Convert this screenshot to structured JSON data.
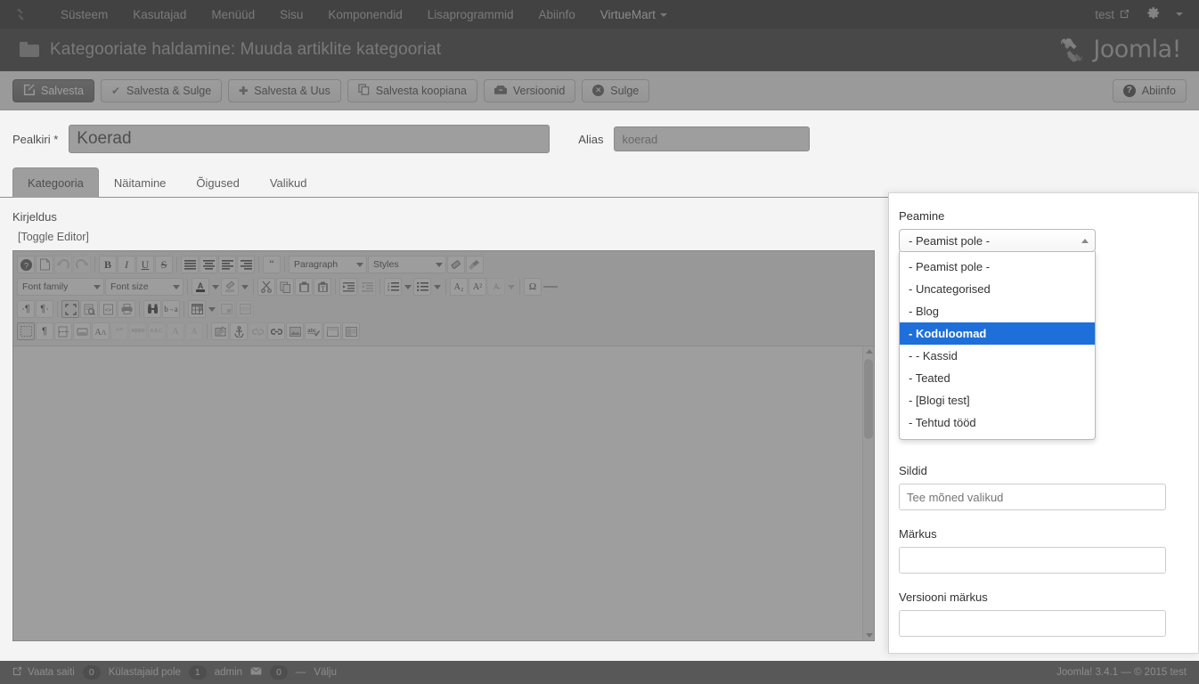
{
  "topbar": {
    "logo_icon": "joomla-logo-icon",
    "nav": [
      {
        "label": "Süsteem"
      },
      {
        "label": "Kasutajad"
      },
      {
        "label": "Menüüd"
      },
      {
        "label": "Sisu"
      },
      {
        "label": "Komponendid"
      },
      {
        "label": "Lisaprogrammid"
      },
      {
        "label": "Abiinfo"
      },
      {
        "label": "VirtueMart"
      }
    ],
    "user_label": "test",
    "user_icon": "external-link-icon",
    "gear_icon": "gear-icon",
    "caret_icon": "chevron-down-icon"
  },
  "header": {
    "icon": "folder-icon",
    "title": "Kategooriate haldamine: Muuda artiklite kategooriat",
    "brand": "Joomla!",
    "brand_mark": "®"
  },
  "toolbar": {
    "buttons": [
      {
        "label": "Salvesta",
        "icon": "edit-pencil-icon",
        "style": "primary"
      },
      {
        "label": "Salvesta & Sulge",
        "icon": "check-icon",
        "style": "default"
      },
      {
        "label": "Salvesta & Uus",
        "icon": "plus-icon",
        "style": "default"
      },
      {
        "label": "Salvesta koopiana",
        "icon": "copy-icon",
        "style": "default"
      },
      {
        "label": "Versioonid",
        "icon": "archive-icon",
        "style": "default"
      },
      {
        "label": "Sulge",
        "icon": "close-circle-icon",
        "style": "default"
      }
    ],
    "help": {
      "label": "Abiinfo",
      "icon": "question-circle-icon"
    }
  },
  "form": {
    "title_label": "Pealkiri *",
    "title_value": "Koerad",
    "alias_label": "Alias",
    "alias_placeholder": "koerad"
  },
  "tabs": [
    {
      "label": "Kategooria",
      "active": true
    },
    {
      "label": "Näitamine",
      "active": false
    },
    {
      "label": "Õigused",
      "active": false
    },
    {
      "label": "Valikud",
      "active": false
    }
  ],
  "editor": {
    "field_label": "Kirjeldus",
    "toggle_label": "[Toggle Editor]",
    "row1": [
      {
        "icon": "help-circle-icon",
        "type": "btn"
      },
      {
        "icon": "new-document-icon",
        "type": "btn"
      },
      {
        "icon": "undo-icon",
        "type": "btn",
        "dim": true
      },
      {
        "icon": "redo-icon",
        "type": "btn",
        "dim": true
      },
      {
        "icon": "bold-icon",
        "type": "btn",
        "glyph": "B"
      },
      {
        "icon": "italic-icon",
        "type": "btn",
        "glyph": "I"
      },
      {
        "icon": "underline-icon",
        "type": "btn",
        "glyph": "U"
      },
      {
        "icon": "strikethrough-icon",
        "type": "btn",
        "glyph": "S"
      },
      {
        "icon": "align-left-icon",
        "type": "btn"
      },
      {
        "icon": "align-center-icon",
        "type": "btn"
      },
      {
        "icon": "align-right-icon",
        "type": "btn"
      },
      {
        "icon": "align-justify-icon",
        "type": "btn"
      },
      {
        "icon": "blockquote-icon",
        "type": "btn",
        "glyph": "“"
      },
      {
        "icon": "paragraph-format-select",
        "type": "select",
        "label": "Paragraph",
        "width": 88
      },
      {
        "icon": "styles-select",
        "type": "select",
        "label": "Styles",
        "width": 88
      },
      {
        "icon": "eraser-icon",
        "type": "btn"
      },
      {
        "icon": "cleanup-broom-icon",
        "type": "btn"
      }
    ],
    "row2": [
      {
        "icon": "font-family-select",
        "type": "select",
        "label": "Font family",
        "width": 98
      },
      {
        "icon": "font-size-select",
        "type": "select",
        "label": "Font size",
        "width": 88
      },
      {
        "icon": "text-color-icon",
        "type": "btn",
        "glyph": "A"
      },
      {
        "icon": "text-color-chevron-icon",
        "type": "caret"
      },
      {
        "icon": "highlight-color-icon",
        "type": "btn"
      },
      {
        "icon": "highlight-color-chevron-icon",
        "type": "caret"
      },
      {
        "icon": "cut-scissors-icon",
        "type": "btn"
      },
      {
        "icon": "copy-icon",
        "type": "btn"
      },
      {
        "icon": "paste-icon",
        "type": "btn"
      },
      {
        "icon": "paste-as-text-icon",
        "type": "btn"
      },
      {
        "icon": "indent-icon",
        "type": "btn"
      },
      {
        "icon": "outdent-icon",
        "type": "btn",
        "dim": true
      },
      {
        "icon": "ordered-list-icon",
        "type": "btn"
      },
      {
        "icon": "ordered-list-chevron-icon",
        "type": "caret"
      },
      {
        "icon": "unordered-list-icon",
        "type": "btn"
      },
      {
        "icon": "unordered-list-chevron-icon",
        "type": "caret"
      },
      {
        "icon": "subscript-icon",
        "type": "btn",
        "glyph": "A₂"
      },
      {
        "icon": "superscript-icon",
        "type": "btn",
        "glyph": "A²"
      },
      {
        "icon": "remove-format-icon",
        "type": "btn",
        "dim": true
      },
      {
        "icon": "remove-format-chevron-icon",
        "type": "caret",
        "dim": true
      },
      {
        "icon": "special-character-icon",
        "type": "btn",
        "glyph": "Ω"
      },
      {
        "icon": "horizontal-rule-icon",
        "type": "btn",
        "glyph": "—",
        "plain": true
      }
    ],
    "row3": [
      {
        "icon": "ltr-direction-icon",
        "type": "btn",
        "glyph": "¶"
      },
      {
        "icon": "rtl-direction-icon",
        "type": "btn",
        "glyph": "¶"
      },
      {
        "icon": "fullscreen-icon",
        "type": "btn",
        "pressed": true
      },
      {
        "icon": "preview-icon",
        "type": "btn"
      },
      {
        "icon": "source-code-icon",
        "type": "btn",
        "glyph": "<>"
      },
      {
        "icon": "print-icon",
        "type": "btn"
      },
      {
        "icon": "search-binoculars-icon",
        "type": "btn"
      },
      {
        "icon": "replace-icon",
        "type": "btn"
      },
      {
        "icon": "table-icon",
        "type": "btn"
      },
      {
        "icon": "table-chevron-icon",
        "type": "caret"
      },
      {
        "icon": "delete-table-icon",
        "type": "btn",
        "dim": true
      },
      {
        "icon": "table-row-properties-icon",
        "type": "btn",
        "dim": true
      }
    ],
    "row4": [
      {
        "icon": "visual-aid-icon",
        "type": "btn",
        "pressed": true
      },
      {
        "icon": "invisible-characters-icon",
        "type": "btn",
        "glyph": "¶"
      },
      {
        "icon": "page-break-icon",
        "type": "btn"
      },
      {
        "icon": "insert-template-icon",
        "type": "btn"
      },
      {
        "icon": "text-case-icon",
        "type": "btn",
        "glyph": "AA"
      },
      {
        "icon": "quote-icon",
        "type": "btn",
        "dim": true,
        "glyph": "“”"
      },
      {
        "icon": "abbreviation-icon",
        "type": "btn",
        "dim": true,
        "glyph": "ABBR"
      },
      {
        "icon": "acronym-icon",
        "type": "btn",
        "dim": true,
        "glyph": "A.B.C."
      },
      {
        "icon": "remove-link-icon",
        "type": "btn",
        "dim": true,
        "glyph": "A"
      },
      {
        "icon": "insert-link-icon",
        "type": "btn",
        "dim": true,
        "glyph": "A"
      },
      {
        "icon": "attributes-icon",
        "type": "btn"
      },
      {
        "icon": "anchor-icon",
        "type": "btn"
      },
      {
        "icon": "unlink-icon",
        "type": "btn",
        "dim": true
      },
      {
        "icon": "link-icon",
        "type": "btn"
      },
      {
        "icon": "image-icon",
        "type": "btn"
      },
      {
        "icon": "spellcheck-icon",
        "type": "btn",
        "glyph": "abc"
      },
      {
        "icon": "insert-layer-icon",
        "type": "btn"
      },
      {
        "icon": "media-icon",
        "type": "btn"
      }
    ],
    "content": ""
  },
  "panel": {
    "parent_label": "Peamine",
    "select_value": "- Peamist pole -",
    "select_caret": "chevron-up-icon",
    "options": [
      {
        "label": "- Peamist pole -",
        "selected": false
      },
      {
        "label": "- Uncategorised",
        "selected": false
      },
      {
        "label": "- Blog",
        "selected": false
      },
      {
        "label": "- Koduloomad",
        "selected": true
      },
      {
        "label": "- - Kassid",
        "selected": false
      },
      {
        "label": "- Teated",
        "selected": false
      },
      {
        "label": "- [Blogi test]",
        "selected": false
      },
      {
        "label": "- Tehtud tööd",
        "selected": false
      }
    ],
    "tags_label": "Sildid",
    "tags_placeholder": "Tee mõned valikud",
    "note_label": "Märkus",
    "note_value": "",
    "version_note_label": "Versiooni märkus",
    "version_note_value": ""
  },
  "statusbar": {
    "view_site_label": "Vaata saiti",
    "view_site_icon": "external-link-icon",
    "visitors_count": "0",
    "visitors_label": "Külastajaid pole",
    "admin_count": "1",
    "admin_label": "admin",
    "mail_icon": "envelope-icon",
    "mail_count": "0",
    "separator": "—",
    "logout_label": "Välju",
    "copyright": "Joomla! 3.4.1  —  © 2015 test"
  },
  "colors": {
    "topbar_bg": "#101523",
    "header_bg": "#1c2438",
    "primary_green": "#2f8b3f",
    "select_highlight": "#1e6fd9",
    "status_bg": "#4d4d4d"
  }
}
